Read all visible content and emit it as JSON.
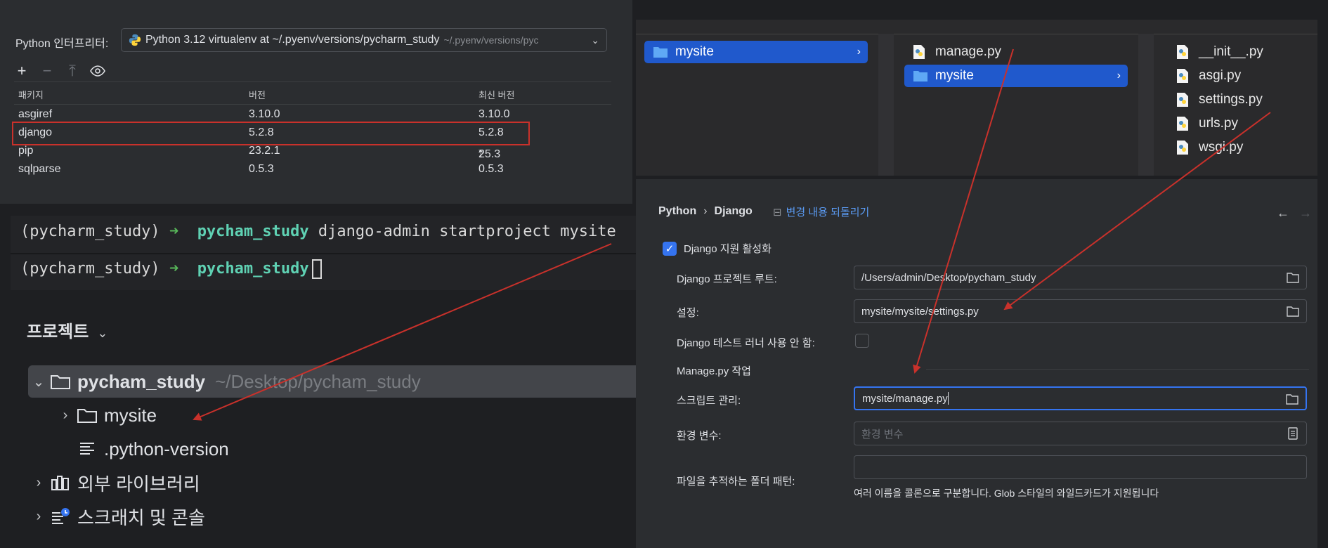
{
  "interpreter": {
    "label": "Python 인터프리터:",
    "selected": "Python 3.12 virtualenv at ~/.pyenv/versions/pycharm_study",
    "selected_path": "~/.pyenv/versions/pyc"
  },
  "packages": {
    "headers": [
      "패키지",
      "버전",
      "최신 버전"
    ],
    "rows": [
      {
        "name": "asgiref",
        "version": "3.10.0",
        "latest": "3.10.0",
        "upgrade": false
      },
      {
        "name": "django",
        "version": "5.2.8",
        "latest": "5.2.8",
        "upgrade": false
      },
      {
        "name": "pip",
        "version": "23.2.1",
        "latest": "25.3",
        "upgrade": true
      },
      {
        "name": "sqlparse",
        "version": "0.5.3",
        "latest": "0.5.3",
        "upgrade": false
      }
    ],
    "highlight_color": "#c9312b"
  },
  "terminal": {
    "line1": {
      "env": "(pycharm_study)",
      "arrow": "➜",
      "dir": "pycham_study",
      "cmd": "django-admin startproject mysite"
    },
    "line2": {
      "env": "(pycharm_study)",
      "arrow": "➜",
      "dir": "pycham_study"
    }
  },
  "project": {
    "title": "프로젝트",
    "root": {
      "name": "pycham_study",
      "path": "~/Desktop/pycham_study"
    },
    "child_folder": "mysite",
    "child_file": ".python-version",
    "external_libs": "외부 라이브러리",
    "scratches": "스크래치 및 콘솔"
  },
  "finder": {
    "col1": [
      "mysite"
    ],
    "col2": [
      "manage.py",
      "mysite"
    ],
    "col3": [
      "__init__.py",
      "asgi.py",
      "settings.py",
      "urls.py",
      "wsgi.py"
    ],
    "selection_color": "#2059cc"
  },
  "settings": {
    "breadcrumb": [
      "Python",
      "Django"
    ],
    "revert_label": "변경 내용 되돌리기",
    "enable_label": "Django 지원 활성화",
    "enable_checked": true,
    "root_label": "Django 프로젝트 루트:",
    "root_value": "/Users/admin/Desktop/pycham_study",
    "settings_label": "설정:",
    "settings_value": "mysite/mysite/settings.py",
    "test_runner_label": "Django 테스트 러너 사용 안 함:",
    "test_runner_checked": false,
    "manage_section": "Manage.py 작업",
    "script_label": "스크립트 관리:",
    "script_value": "mysite/manage.py",
    "env_label": "환경 변수:",
    "env_placeholder": "환경 변수",
    "folder_pattern_label": "파일을 추적하는 폴더 패턴:",
    "folder_pattern_value": "",
    "hint": "여러 이름을 콜론으로 구분합니다. Glob 스타일의 와일드카드가 지원됩니다",
    "accent": "#3574f0"
  },
  "annotation_color": "#c9312b"
}
